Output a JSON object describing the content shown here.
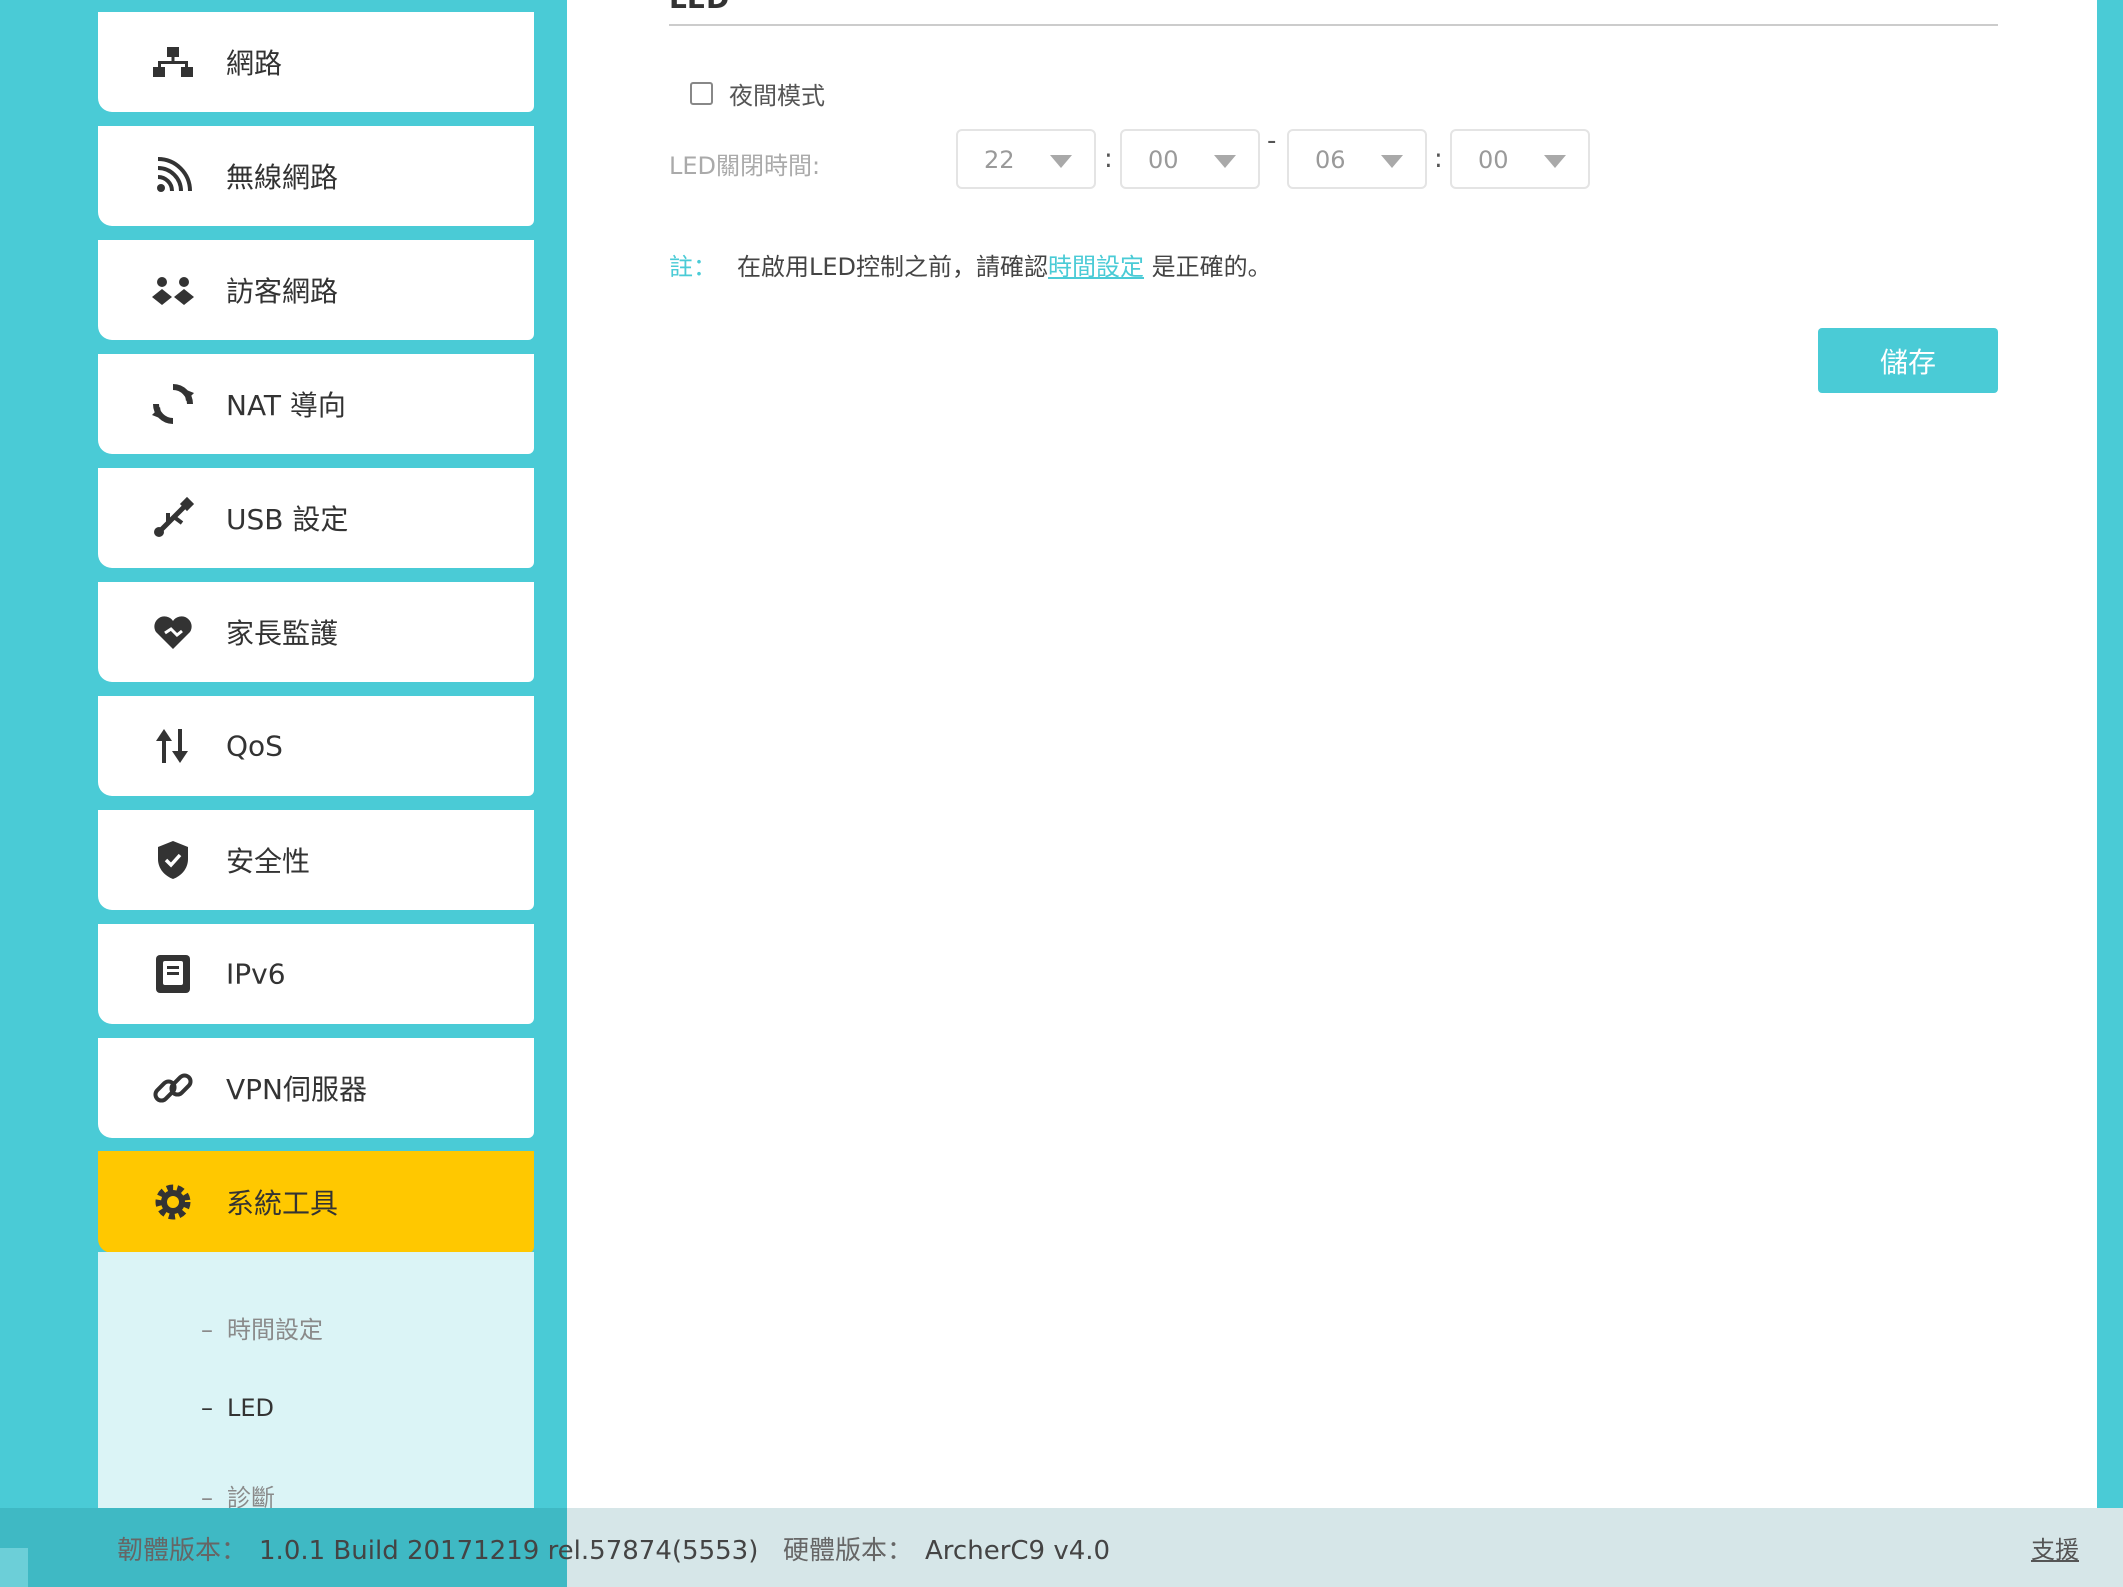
{
  "sidebar": {
    "items": [
      {
        "label": "網路",
        "icon": "network-icon"
      },
      {
        "label": "無線網路",
        "icon": "wireless-icon"
      },
      {
        "label": "訪客網路",
        "icon": "guest-network-icon"
      },
      {
        "label": "NAT 導向",
        "icon": "nat-forwarding-icon"
      },
      {
        "label": "USB 設定",
        "icon": "usb-icon"
      },
      {
        "label": "家長監護",
        "icon": "parental-control-icon"
      },
      {
        "label": "QoS",
        "icon": "qos-icon"
      },
      {
        "label": "安全性",
        "icon": "shield-icon"
      },
      {
        "label": "IPv6",
        "icon": "ipv6-icon"
      },
      {
        "label": "VPN伺服器",
        "icon": "vpn-link-icon"
      },
      {
        "label": "系統工具",
        "icon": "gear-icon",
        "active": true
      }
    ],
    "submenu": [
      {
        "label": "時間設定"
      },
      {
        "label": "LED",
        "current": true
      },
      {
        "label": "診斷"
      }
    ],
    "submenu_dash": "–"
  },
  "main": {
    "section_title": "LED",
    "night_mode_label": "夜間模式",
    "night_mode_checked": false,
    "led_off_label": "LED關閉時間:",
    "time": {
      "start_hour": "22",
      "start_minute": "00",
      "range_separator": "-",
      "colon": ":",
      "end_hour": "06",
      "end_minute": "00"
    },
    "note": {
      "prefix": "註：",
      "text_before": "在啟用LED控制之前，請確認",
      "link": "時間設定",
      "text_after": " 是正確的。"
    },
    "save_label": "儲存"
  },
  "footer": {
    "firmware_key": "韌體版本：",
    "firmware_value": "1.0.1 Build 20171219 rel.57874(5553)",
    "hardware_key": "硬體版本：",
    "hardware_value": "ArcherC9 v4.0",
    "support_label": "支援"
  },
  "colors": {
    "accent": "#4acbd6",
    "active": "#ffc800",
    "submenu_bg": "#dbf4f6",
    "footer_bg": "#d6e6e8"
  }
}
